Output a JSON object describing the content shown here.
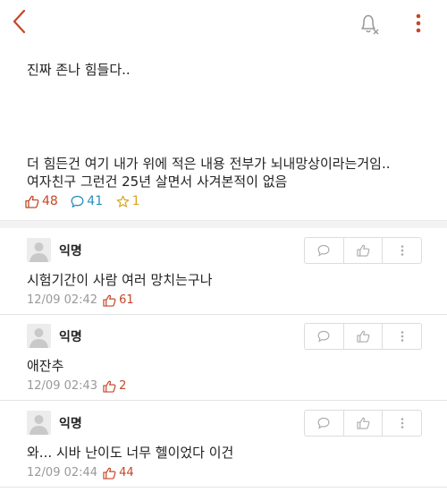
{
  "header": {
    "back_icon": "chevron-left-icon",
    "notify_icon": "bell-off-icon",
    "more_icon": "vertical-dots-icon"
  },
  "post": {
    "line1": "진짜 존나 힘들다..",
    "line2": "더 힘든건 여기 내가 위에 적은 내용 전부가 뇌내망상이라는거임..",
    "line3": "여자친구 그런건 25년 살면서 사겨본적이 없음",
    "likes": "48",
    "comments": "41",
    "scraps": "1"
  },
  "comments": [
    {
      "author": "익명",
      "text": "시험기간이 사람 여러 망치는구나",
      "time": "12/09 02:42",
      "likes": "61"
    },
    {
      "author": "익명",
      "text": "애잔추",
      "time": "12/09 02:43",
      "likes": "2"
    },
    {
      "author": "익명",
      "text": "와... 시바 난이도 너무 헬이었다 이건",
      "time": "12/09 02:44",
      "likes": "44"
    }
  ],
  "colors": {
    "accent": "#c4472a",
    "comment_blue": "#2a8fbf",
    "scrap_gold": "#d9a520"
  }
}
